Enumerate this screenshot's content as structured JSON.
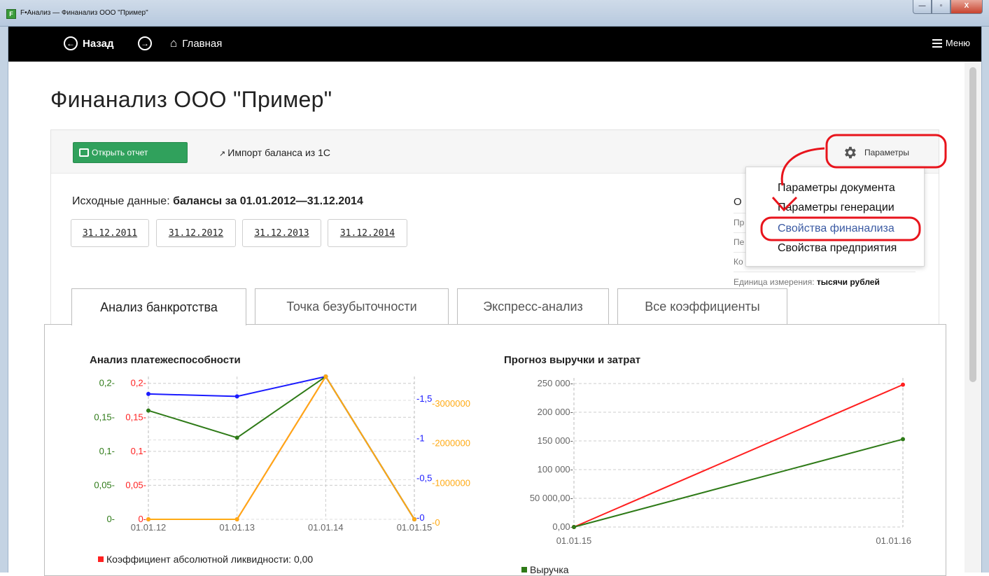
{
  "window": {
    "title": "F•Анализ — Финанализ ООО \"Пример\"",
    "icon": "F",
    "buttons": {
      "minimize": "—",
      "maximize": "▫",
      "close": "X"
    }
  },
  "nav": {
    "back_label": "Назад",
    "forward_icon": "arrow-right",
    "home_label": "Главная",
    "menu_label": "Меню"
  },
  "page": {
    "title": "Финанализ ООО \"Пример\""
  },
  "toolbar": {
    "open_report": "Открыть отчет",
    "import_balance": "Импорт баланса из 1С",
    "params": "Параметры"
  },
  "source": {
    "label": "Исходные данные:",
    "value": "балансы за 01.01.2012—31.12.2014",
    "dates": [
      "31.12.2011",
      "31.12.2012",
      "31.12.2013",
      "31.12.2014"
    ]
  },
  "right_info": {
    "heading": "О",
    "lines": [
      "Пр",
      "Пе",
      "Ко"
    ],
    "unit_label": "Единица измерения:",
    "unit_value": "тысячи рублей"
  },
  "dropdown": {
    "items": [
      "Параметры документа",
      "Параметры генерации",
      "Свойства финанализа",
      "Свойства предприятия"
    ],
    "highlighted_index": 2
  },
  "tabs": {
    "items": [
      "Анализ банкротства",
      "Точка безубыточности",
      "Экспресс-анализ",
      "Все коэффициенты"
    ],
    "active_index": 0
  },
  "colors": {
    "accent_green": "#30a15c",
    "annotation_red": "#e8141c",
    "series_red": "#ff2020",
    "series_green": "#2e7a17",
    "series_blue": "#1b1bff",
    "series_orange": "#ffaa14",
    "link_blue": "#3b5aa3"
  },
  "chart_data": [
    {
      "type": "line",
      "title": "Анализ платежеспособности",
      "x": [
        "01.01.12",
        "01.01.13",
        "01.01.14",
        "01.01.15"
      ],
      "axes": {
        "left_green": {
          "ticks": [
            "0",
            "0,05",
            "0,1",
            "0,15",
            "0,2"
          ],
          "ylim": [
            0,
            0.21
          ]
        },
        "left_red": {
          "ticks": [
            "0",
            "0,05",
            "0,1",
            "0,15",
            "0,2"
          ],
          "ylim": [
            0,
            0.21
          ]
        },
        "right_blue": {
          "ticks": [
            "0",
            "0,5",
            "1",
            "1,5"
          ],
          "ylim": [
            0,
            1.8
          ]
        },
        "right_orange": {
          "ticks": [
            "0",
            "1000000",
            "2000000",
            "3000000"
          ],
          "ylim": [
            0,
            3600000
          ]
        }
      },
      "series": [
        {
          "name": "Коэффициент абсолютной ликвидности: 0,00",
          "color": "#ff2020",
          "axis": "left_red",
          "values": [
            0,
            0,
            0.21,
            0
          ]
        },
        {
          "color": "#2e7a17",
          "axis": "left_green",
          "values": [
            0.16,
            0.12,
            0.21,
            0
          ]
        },
        {
          "color": "#1b1bff",
          "axis": "right_blue",
          "values": [
            1.58,
            1.55,
            1.8,
            0
          ]
        },
        {
          "color": "#ffaa14",
          "axis": "right_orange",
          "values": [
            0,
            0,
            3600000,
            0
          ]
        }
      ],
      "grid": true
    },
    {
      "type": "line",
      "title": "Прогноз выручки и затрат",
      "x": [
        "01.01.15",
        "01.01.16"
      ],
      "yticks": [
        "0,00",
        "50 000,00",
        "100 000",
        "150 000",
        "200 000",
        "250 000"
      ],
      "ylim": [
        0,
        250000
      ],
      "series": [
        {
          "color": "#ff2020",
          "values": [
            0,
            248000
          ]
        },
        {
          "name": "Выручка",
          "color": "#2e7a17",
          "values": [
            0,
            153000
          ]
        }
      ],
      "grid": true
    }
  ]
}
